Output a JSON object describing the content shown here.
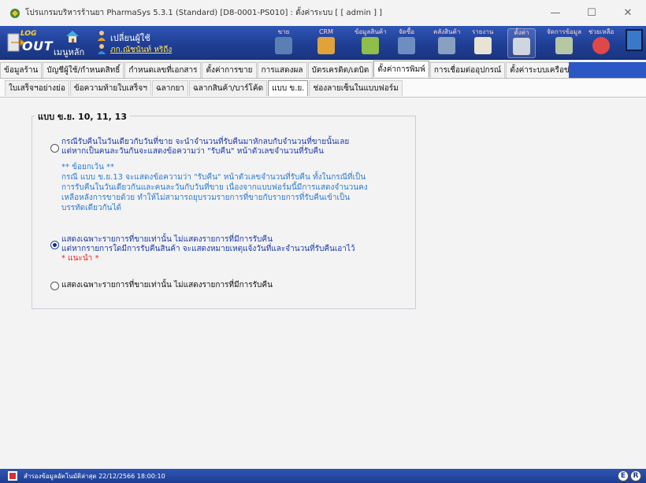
{
  "window": {
    "title": "โปรแกรมบริหารร้านยา PharmaSys 5.3.1 (Standard) [D8-0001-PS010] : ตั้งค่าระบบ  [ [ admin ] ]",
    "minimize": "—",
    "maximize": "☐",
    "close": "✕"
  },
  "toolbar": {
    "logout_top": "LOG",
    "logout_bottom": "OUT",
    "home_label": "เมนูหลัก",
    "switch_user_label": "เปลี่ยนผู้ใช้",
    "user_name": "ภก.ณัชนันท์ หริถีง",
    "buttons": [
      {
        "label": "ขาย",
        "color": "#5b7fb3"
      },
      {
        "label": "CRM",
        "color": "#e0a23a"
      },
      {
        "label": "ข้อมูลสินค้า",
        "color": "#8fbf49"
      },
      {
        "label": "จัดซื้อ",
        "color": "#6d8ebf"
      },
      {
        "label": "คลังสินค้า",
        "color": "#8aa0c0"
      },
      {
        "label": "รายงาน",
        "color": "#e8e3d2"
      },
      {
        "label": "ตั้งค่า",
        "color": "#cfd6df"
      },
      {
        "label": "จัดการข้อมูล",
        "color": "#b6c7a3"
      },
      {
        "label": "ช่วยเหลือ",
        "color": "#e04848"
      }
    ]
  },
  "tabs_main": [
    {
      "label": "ข้อมูลร้าน",
      "active": false
    },
    {
      "label": "บัญชีผู้ใช้/กำหนดสิทธิ์",
      "active": false
    },
    {
      "label": "กำหนดเลขที่เอกสาร",
      "active": false
    },
    {
      "label": "ตั้งค่าการขาย",
      "active": false
    },
    {
      "label": "การแสดงผล",
      "active": false
    },
    {
      "label": "บัตรเครดิต/เดบิต",
      "active": false
    },
    {
      "label": "ตั้งค่าการพิมพ์",
      "active": true
    },
    {
      "label": "การเชื่อมต่ออุปกรณ์",
      "active": false
    },
    {
      "label": "ตั้งค่าระบบเครือข่าย",
      "active": false
    }
  ],
  "tabs_sub": [
    {
      "label": "ใบเสร็จฯอย่างย่อ",
      "active": false
    },
    {
      "label": "ข้อความท้ายใบเสร็จฯ",
      "active": false
    },
    {
      "label": "ฉลากยา",
      "active": false
    },
    {
      "label": "ฉลากสินค้า/บาร์โค้ด",
      "active": false
    },
    {
      "label": "แบบ ข.ย.",
      "active": true
    },
    {
      "label": "ช่องลายเซ็นในแบบฟอร์ม",
      "active": false
    }
  ],
  "group": {
    "title": "แบบ ข.ย. 10, 11, 13",
    "option1": {
      "line1": "กรณีรับคืนในวันเดียวกับวันที่ขาย จะนำจำนวนที่รับคืนมาหักลบกับจำนวนที่ขายนั้นเลย",
      "line2": "แต่หากเป็นคนละวันกันจะแสดงข้อความว่า \"รับคืน\" หน้าตัวเลขจำนวนที่รับคืน",
      "exception_title": "** ข้อยกเว้น **",
      "exception_lines": [
        "กรณี แบบ ข.ย.13 จะแสดงข้อความว่า \"รับคืน\" หน้าตัวเลขจำนวนที่รับคืน ทั้งในกรณีที่เป็น",
        "การรับคืนในวันเดียวกันและคนละวันกับวันที่ขาย เนื่องจากแบบฟอร์มนี้มีการแสดงจำนวนคง",
        "เหลือหลังการขายด้วย ทำให้ไม่สามารถยุบรวมรายการที่ขายกับรายการที่รับคืนเข้าเป็น",
        "บรรทัดเดียวกันได้"
      ],
      "checked": false
    },
    "option2": {
      "line1": "แสดงเฉพาะรายการที่ขายเท่านั้น ไม่แสดงรายการที่มีการรับคืน",
      "line2": "แต่หากรายการใดมีการรับคืนสินค้า จะแสดงหมายเหตุแจ้งวันที่และจำนวนที่รับคืนเอาไว้",
      "recommend": "* แนะนำ *",
      "checked": true
    },
    "option3": {
      "line1": "แสดงเฉพาะรายการที่ขายเท่านั้น ไม่แสดงรายการที่มีการรับคืน",
      "checked": false
    }
  },
  "statusbar": {
    "text": "สำรองข้อมูลอัตโนมัติล่าสุด  22/12/2566 18:00:10",
    "badges": [
      "E",
      "R"
    ]
  }
}
